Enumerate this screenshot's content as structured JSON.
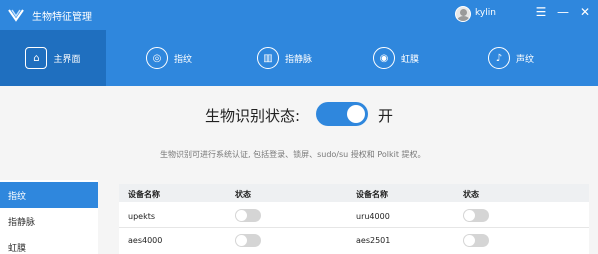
{
  "titlebar": {
    "title": "生物特征管理",
    "user_name": "kylin",
    "menu_icon": "☰",
    "minimize_icon": "—",
    "close_icon": "✕"
  },
  "nav": {
    "tabs": [
      {
        "label": "主界面",
        "icon": "⌂"
      },
      {
        "label": "指纹",
        "icon": "◎"
      },
      {
        "label": "指静脉",
        "icon": "▥"
      },
      {
        "label": "虹膜",
        "icon": "◉"
      },
      {
        "label": "声纹",
        "icon": "♪"
      }
    ],
    "active_tab": "主界面"
  },
  "status": {
    "label": "生物识别状态:",
    "value": "开",
    "enabled": true,
    "description": "生物识别可进行系统认证, 包括登录、锁屏、sudo/su 授权和 Polkit 提权。"
  },
  "sidebar": {
    "items": [
      {
        "label": "指纹"
      },
      {
        "label": "指静脉"
      },
      {
        "label": "虹膜"
      }
    ],
    "active_item": "指纹"
  },
  "devices": {
    "headers": {
      "name": "设备名称",
      "status": "状态"
    },
    "rows": [
      {
        "left": {
          "name": "upekts",
          "enabled": false
        },
        "right": {
          "name": "uru4000",
          "enabled": false
        }
      },
      {
        "left": {
          "name": "aes4000",
          "enabled": false
        },
        "right": {
          "name": "aes2501",
          "enabled": false
        }
      }
    ]
  },
  "colors": {
    "accent": "#2f87dd",
    "active_tab": "#1f6fbf",
    "toggle_off": "#d5d5d5"
  }
}
